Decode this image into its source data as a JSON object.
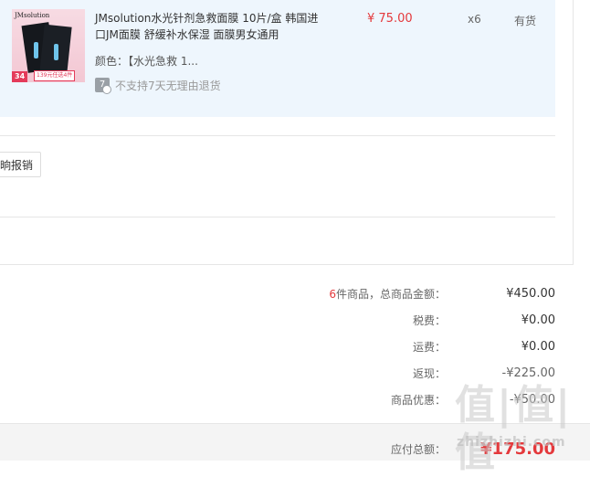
{
  "item": {
    "thumbnail": {
      "brand": "JMsolution",
      "price_badge": "34",
      "promo_badge": "139元任选4件"
    },
    "title": "JMsolution水光针剂急救面膜 10片/盒 韩国进口JM面膜 舒缓补水保湿 面膜男女通用",
    "color": "颜色：【水光急救 1...",
    "return_badge_icon": "no-return-icon",
    "return_badge_glyph": "7",
    "return_policy": "不支持7天无理由退货",
    "price": "¥ 75.00",
    "quantity": "x6",
    "stock": "有货"
  },
  "actions": {
    "partial_button": "晌报销"
  },
  "summary": {
    "items_count": "6",
    "items_label": "件商品，总商品金额：",
    "items_total": "¥450.00",
    "tax_label": "税费：",
    "tax_value": "¥0.00",
    "shipping_label": "运费：",
    "shipping_value": "¥0.00",
    "rebate_label": "返现：",
    "rebate_value": "-¥225.00",
    "discount_label": "商品优惠：",
    "discount_value": "-¥50.00",
    "payable_label": "应付总额：",
    "payable_value": "¥175.00"
  },
  "watermark": {
    "glyphs": "值|值|值",
    "url": "zhizhizhi.com"
  },
  "colors": {
    "accent_red": "#e4393c",
    "item_panel_bg": "#eef6fd",
    "total_bar_bg": "#f4f4f4"
  }
}
